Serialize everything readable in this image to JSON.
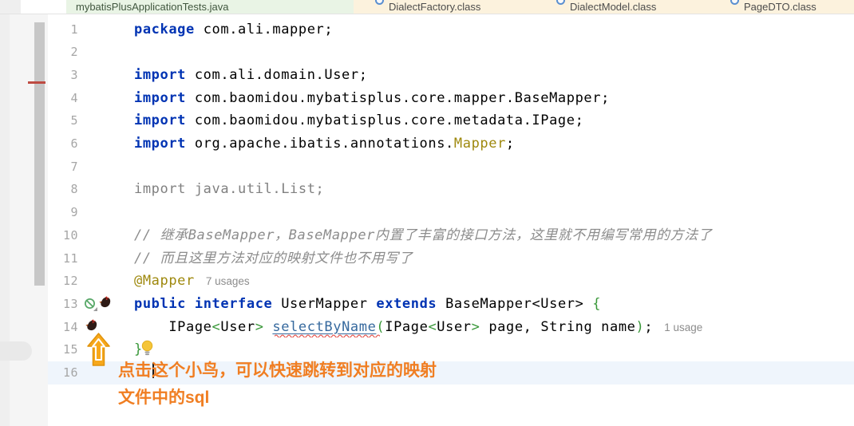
{
  "tabs": [
    {
      "label": "mybatisPlusApplicationTests.java",
      "kind": "test-file-tab"
    },
    {
      "label": "DialectFactory.class",
      "kind": "class-tab"
    },
    {
      "label": "DialectModel.class",
      "kind": "class-tab"
    },
    {
      "label": "PageDTO.class",
      "kind": "class-tab"
    }
  ],
  "editor": {
    "current_line": 16,
    "lines": [
      {
        "num": 1,
        "tokens": [
          [
            "kw",
            "package"
          ],
          [
            "pl",
            " com.ali.mapper;"
          ]
        ]
      },
      {
        "num": 2,
        "tokens": []
      },
      {
        "num": 3,
        "tokens": [
          [
            "kw",
            "import"
          ],
          [
            "pl",
            " com.ali.domain.User;"
          ]
        ]
      },
      {
        "num": 4,
        "tokens": [
          [
            "kw",
            "import"
          ],
          [
            "pl",
            " com.baomidou.mybatisplus.core.mapper.BaseMapper;"
          ]
        ]
      },
      {
        "num": 5,
        "tokens": [
          [
            "kw",
            "import"
          ],
          [
            "pl",
            " com.baomidou.mybatisplus.core.metadata.IPage;"
          ]
        ]
      },
      {
        "num": 6,
        "tokens": [
          [
            "kw",
            "import"
          ],
          [
            "pl",
            " org.apache.ibatis.annotations."
          ],
          [
            "ann",
            "Mapper"
          ],
          [
            "pl",
            ";"
          ]
        ]
      },
      {
        "num": 7,
        "tokens": []
      },
      {
        "num": 8,
        "tokens": [
          [
            "gray",
            "import java.util.List;"
          ]
        ]
      },
      {
        "num": 9,
        "tokens": []
      },
      {
        "num": 10,
        "tokens": [
          [
            "cmt",
            "// 继承BaseMapper，BaseMapper内置了丰富的接口方法，这里就不用编写常用的方法了"
          ]
        ]
      },
      {
        "num": 11,
        "tokens": [
          [
            "cmt",
            "// 而且这里方法对应的映射文件也不用写了"
          ]
        ]
      },
      {
        "num": 12,
        "tokens": [
          [
            "ann",
            "@Mapper"
          ]
        ],
        "inlay": "7 usages"
      },
      {
        "num": 13,
        "tokens": [
          [
            "kw",
            "public"
          ],
          [
            "pl",
            " "
          ],
          [
            "kw",
            "interface"
          ],
          [
            "pl",
            " UserMapper "
          ],
          [
            "kw",
            "extends"
          ],
          [
            "pl",
            " BaseMapper<User> "
          ],
          [
            "grn",
            "{"
          ]
        ]
      },
      {
        "num": 14,
        "tokens": [
          [
            "pl",
            "    IPage"
          ],
          [
            "grn",
            "<"
          ],
          [
            "pl",
            "User"
          ],
          [
            "grn",
            ">"
          ],
          [
            "pl",
            " "
          ],
          [
            "mth",
            "selectByName"
          ],
          [
            "grn",
            "("
          ],
          [
            "pl",
            "IPage"
          ],
          [
            "grn",
            "<"
          ],
          [
            "pl",
            "User"
          ],
          [
            "grn",
            ">"
          ],
          [
            "pl",
            " page, String name"
          ],
          [
            "grn",
            ")"
          ],
          [
            "pl",
            ";"
          ]
        ],
        "inlay": "1 usage"
      },
      {
        "num": 15,
        "tokens": [
          [
            "grn",
            "}"
          ]
        ]
      },
      {
        "num": 16,
        "tokens": []
      }
    ]
  },
  "annotation": {
    "line1": "点击这个小鸟，可以快速跳转到对应的映射",
    "line2": "文件中的sql"
  },
  "icons": {
    "gutter_line13": [
      "no-implementation-icon",
      "mybatis-bird-icon"
    ],
    "gutter_line14": [
      "mybatis-bird-icon"
    ],
    "intention": "lightbulb-icon",
    "hand_drawn": "up-arrow-icon",
    "tab_icon": "class-icon"
  },
  "colors": {
    "keyword_blue": "#0033b3",
    "annotation_olive": "#9e880d",
    "comment_gray": "#8c8c8c",
    "bracket_green": "#389738",
    "method_blue": "#36699e",
    "error_squiggle_red": "#e2443c",
    "note_orange": "#f07e22",
    "arrow_yellow": "#f7a81b",
    "current_line_blue": "#eff5fc",
    "tab_green_bg": "#e9f4e5",
    "tab_cream_bg": "#fcf2dd",
    "vcs_mark_red": "#be4b42"
  }
}
